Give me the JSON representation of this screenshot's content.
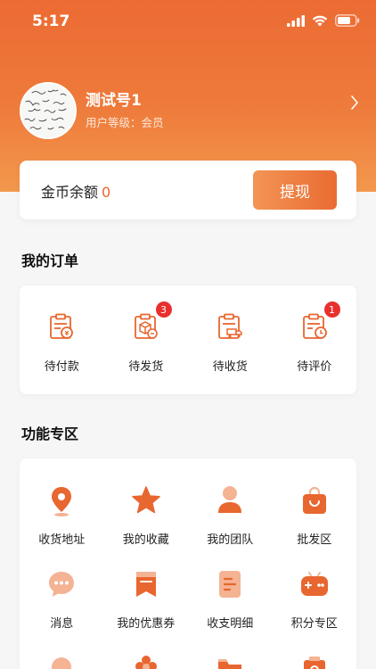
{
  "status_bar": {
    "time": "5:17"
  },
  "profile": {
    "name": "测试号1",
    "level": "用户等级：会员"
  },
  "balance": {
    "label": "金币余额",
    "value": "0",
    "withdraw_label": "提现"
  },
  "orders": {
    "title": "我的订单",
    "items": [
      {
        "label": "待付款",
        "icon": "wallet-clipboard-icon",
        "badge": ""
      },
      {
        "label": "待发货",
        "icon": "package-clipboard-icon",
        "badge": "3"
      },
      {
        "label": "待收货",
        "icon": "truck-clipboard-icon",
        "badge": ""
      },
      {
        "label": "待评价",
        "icon": "clock-clipboard-icon",
        "badge": "1"
      }
    ]
  },
  "functions": {
    "title": "功能专区",
    "items": [
      {
        "label": "收货地址",
        "icon": "location-pin-icon"
      },
      {
        "label": "我的收藏",
        "icon": "star-icon"
      },
      {
        "label": "我的团队",
        "icon": "team-person-icon"
      },
      {
        "label": "批发区",
        "icon": "shopping-bag-icon"
      },
      {
        "label": "消息",
        "icon": "chat-bubble-icon"
      },
      {
        "label": "我的优惠券",
        "icon": "coupon-bookmark-icon"
      },
      {
        "label": "收支明细",
        "icon": "bill-list-icon"
      },
      {
        "label": "积分专区",
        "icon": "game-controller-icon"
      }
    ]
  },
  "colors": {
    "accent": "#e8662f",
    "header_top": "#ec6b33",
    "header_bottom": "#f3984d",
    "badge": "#e8302f"
  }
}
